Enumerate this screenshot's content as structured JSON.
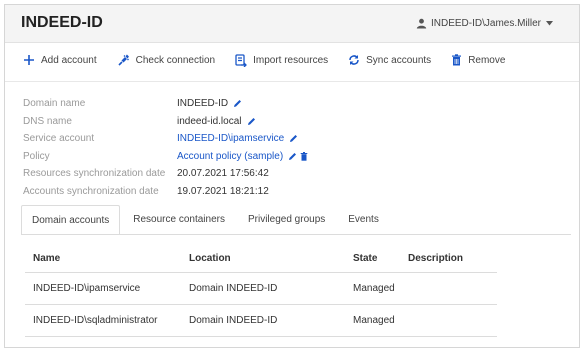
{
  "header": {
    "title": "INDEED-ID",
    "user": "INDEED-ID\\James.Miller"
  },
  "toolbar": {
    "add_account": "Add account",
    "check_connection": "Check connection",
    "import_resources": "Import resources",
    "sync_accounts": "Sync accounts",
    "remove": "Remove"
  },
  "properties": [
    {
      "label": "Domain name",
      "value": "INDEED-ID"
    },
    {
      "label": "DNS name",
      "value": "indeed-id.local"
    },
    {
      "label": "Service account",
      "value": "INDEED-ID\\ipamservice"
    },
    {
      "label": "Policy",
      "value": "Account policy (sample)"
    },
    {
      "label": "Resources synchronization date",
      "value": "20.07.2021 17:56:42"
    },
    {
      "label": "Accounts synchronization date",
      "value": "19.07.2021 18:21:12"
    }
  ],
  "tabs": [
    "Domain accounts",
    "Resource containers",
    "Privileged groups",
    "Events"
  ],
  "table": {
    "columns": [
      "Name",
      "Location",
      "State",
      "Description"
    ],
    "rows": [
      [
        "INDEED-ID\\ipamservice",
        "Domain INDEED-ID",
        "Managed",
        ""
      ],
      [
        "INDEED-ID\\sqladministrator",
        "Domain INDEED-ID",
        "Managed",
        ""
      ]
    ]
  },
  "colors": {
    "accent": "#1a57c8",
    "muted_label": "#9a9a9a",
    "header_bg": "#f4f4f4"
  },
  "icons": [
    "user-icon",
    "caret-down-icon",
    "plus-icon",
    "plug-icon",
    "import-icon",
    "sync-icon",
    "trash-icon",
    "pencil-icon"
  ]
}
